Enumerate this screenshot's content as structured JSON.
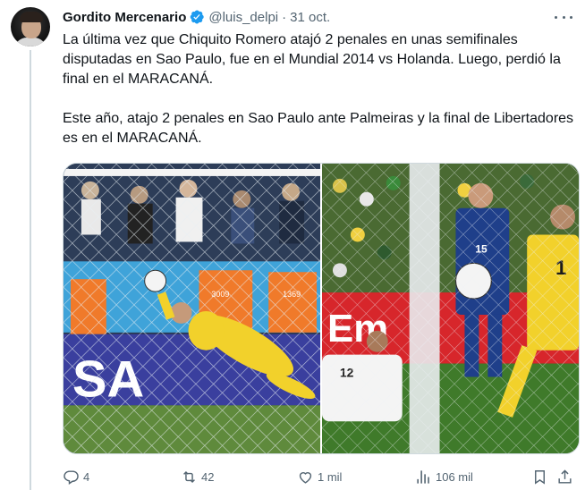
{
  "author": {
    "name": "Gordito Mercenario",
    "handle": "@luis_delpi",
    "date": "31 oct."
  },
  "tweet": {
    "paragraph_1": "La última vez que Chiquito Romero atajó 2 penales en unas semifinales disputadas en Sao Paulo, fue en el Mundial 2014 vs Holanda. Luego, perdió la final en el MARACANÁ.",
    "paragraph_2": "Este año, atajo 2 penales en Sao Paulo ante Palmeiras y la final de Libertadores es en el MARACANÁ."
  },
  "media": {
    "left_photo": {
      "icon": "photo-goalkeeper-save",
      "board_text": "SA",
      "vest_numbers": [
        "3009",
        "1369"
      ]
    },
    "right_photo": {
      "icon": "photo-match-action",
      "board_text": "Em",
      "shirt_numbers": [
        "15",
        "1",
        "12"
      ]
    }
  },
  "actions": {
    "reply": {
      "icon": "reply-icon",
      "count": "4"
    },
    "retweet": {
      "icon": "retweet-icon",
      "count": "42"
    },
    "like": {
      "icon": "heart-icon",
      "count": "1 mil"
    },
    "views": {
      "icon": "views-icon",
      "count": "106 mil"
    },
    "bookmark": {
      "icon": "bookmark-icon"
    },
    "share": {
      "icon": "share-icon"
    }
  },
  "colors": {
    "text": "#0f1419",
    "secondary": "#536471",
    "verified": "#1d9bf0",
    "border": "#cfd9de"
  }
}
